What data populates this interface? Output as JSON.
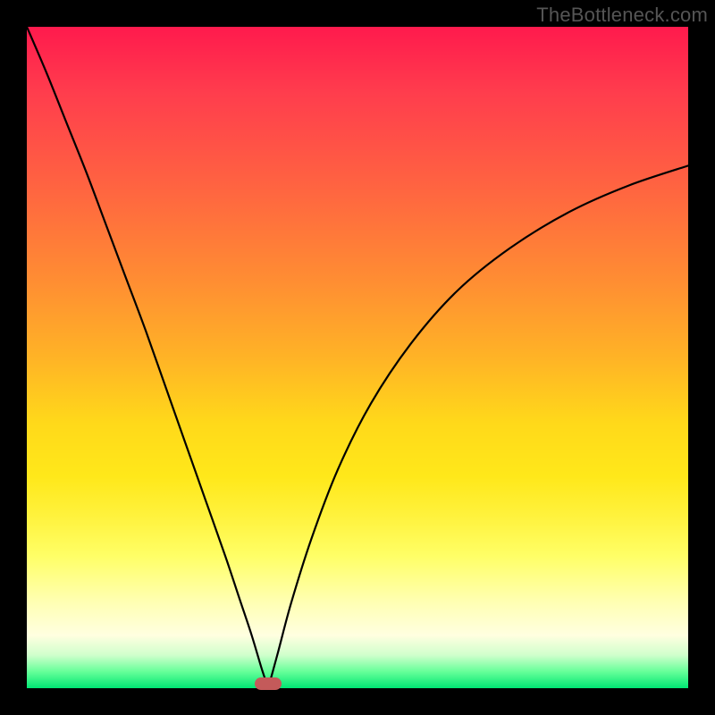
{
  "watermark": "TheBottleneck.com",
  "plot": {
    "inner_size": 740,
    "border": 30
  },
  "marker": {
    "x_frac": 0.365,
    "width": 30,
    "height": 14,
    "color": "#c45a5a"
  },
  "chart_data": {
    "type": "line",
    "title": "",
    "xlabel": "",
    "ylabel": "",
    "xlim": [
      0,
      1
    ],
    "ylim": [
      0,
      1
    ],
    "note": "V-shaped bottleneck curve; y is fraction of plot height from bottom. Minimum (y≈0) near x≈0.365.",
    "series": [
      {
        "name": "left-branch",
        "x": [
          0.0,
          0.03,
          0.06,
          0.09,
          0.12,
          0.15,
          0.18,
          0.21,
          0.24,
          0.27,
          0.3,
          0.32,
          0.34,
          0.355,
          0.365
        ],
        "y": [
          1.0,
          0.93,
          0.855,
          0.78,
          0.7,
          0.62,
          0.54,
          0.455,
          0.37,
          0.285,
          0.2,
          0.14,
          0.08,
          0.03,
          0.0
        ]
      },
      {
        "name": "right-branch",
        "x": [
          0.365,
          0.38,
          0.4,
          0.43,
          0.47,
          0.52,
          0.58,
          0.65,
          0.73,
          0.82,
          0.91,
          1.0
        ],
        "y": [
          0.0,
          0.055,
          0.13,
          0.225,
          0.33,
          0.43,
          0.52,
          0.6,
          0.665,
          0.72,
          0.76,
          0.79
        ]
      }
    ]
  }
}
